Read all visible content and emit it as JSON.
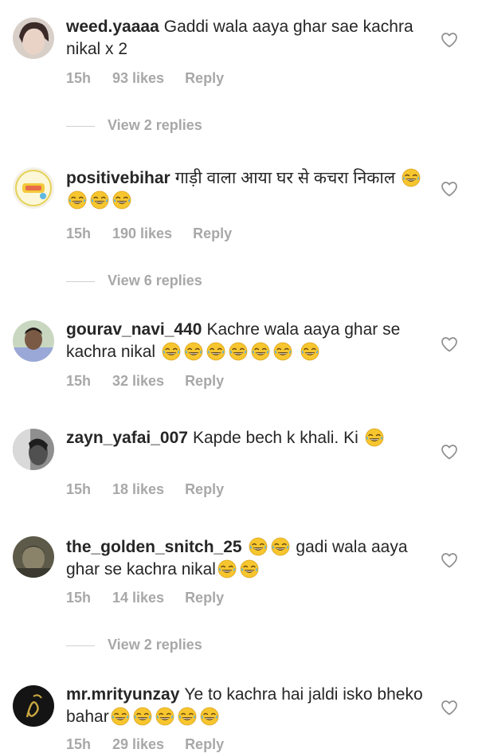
{
  "colors": {
    "text": "#262626",
    "muted": "#a8a8a8",
    "emoji": "#f7c62f"
  },
  "icons": {
    "like": "heart-outline-icon",
    "emoji": "laughing-face-emoji"
  },
  "comments": [
    {
      "username": "weed.yaaaa",
      "text": "Gaddi wala aaya ghar sae kachra nikal x 2",
      "emoji_count": 0,
      "time": "15h",
      "likes": "93 likes",
      "reply": "Reply",
      "view_replies": "View 2 replies"
    },
    {
      "username": "positivebihar",
      "text": "गाड़ी वाला आया घर से कचरा निकाल",
      "emoji_count": 4,
      "time": "15h",
      "likes": "190 likes",
      "reply": "Reply",
      "view_replies": "View 6 replies"
    },
    {
      "username": "gourav_navi_440",
      "text": "Kachre wala aaya ghar se kachra nikal",
      "emoji_count": 7,
      "time": "15h",
      "likes": "32 likes",
      "reply": "Reply",
      "view_replies": ""
    },
    {
      "username": "zayn_yafai_007",
      "text": "Kapde bech k khali. Ki",
      "emoji_count": 1,
      "time": "15h",
      "likes": "18 likes",
      "reply": "Reply",
      "view_replies": ""
    },
    {
      "username": "the_golden_snitch_25",
      "text_before": "",
      "text": "gadi wala aaya ghar se kachra nikal",
      "emoji_count": 2,
      "emoji_after_count": 2,
      "time": "15h",
      "likes": "14 likes",
      "reply": "Reply",
      "view_replies": "View 2 replies"
    },
    {
      "username": "mr.mrityunzay",
      "text": "Ye to kachra hai jaldi isko bheko bahar",
      "emoji_count": 5,
      "time": "15h",
      "likes": "29 likes",
      "reply": "Reply",
      "view_replies": ""
    }
  ]
}
